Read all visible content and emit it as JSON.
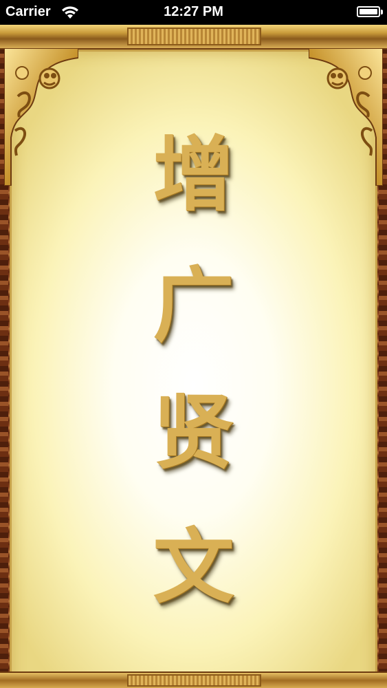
{
  "status_bar": {
    "carrier": "Carrier",
    "time": "12:27 PM",
    "icons": [
      "wifi-icon",
      "battery-icon"
    ]
  },
  "title": {
    "chars": [
      "增",
      "广",
      "贤",
      "文"
    ]
  },
  "colors": {
    "title_gold": "#d9b055",
    "frame_gold": "#c99a3a",
    "frame_wood": "#7a3818",
    "parchment_center": "#ffffff",
    "parchment_edge": "#e9d782"
  }
}
